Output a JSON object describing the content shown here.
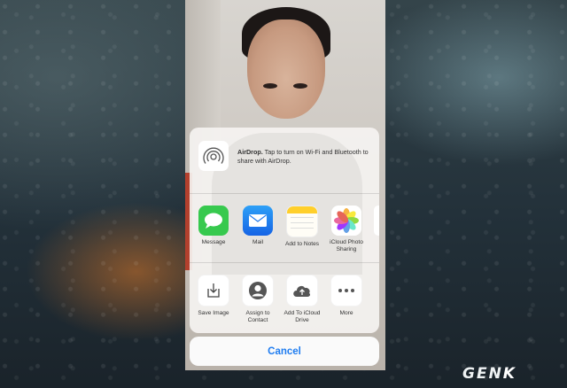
{
  "share_sheet": {
    "airdrop": {
      "title": "AirDrop.",
      "message": "Tap to turn on Wi-Fi and Bluetooth to share with AirDrop."
    },
    "apps": [
      {
        "label": "Message",
        "icon": "messages-icon",
        "color": "#34c759"
      },
      {
        "label": "Mail",
        "icon": "mail-icon",
        "color": "#1e88f0"
      },
      {
        "label": "Add to Notes",
        "icon": "notes-icon",
        "color": "#ffd52b"
      },
      {
        "label": "iCloud Photo Sharing",
        "icon": "photos-icon",
        "color": "#ffffff"
      }
    ],
    "actions": [
      {
        "label": "Save Image",
        "icon": "save-image-icon"
      },
      {
        "label": "Assign to Contact",
        "icon": "contact-icon"
      },
      {
        "label": "Add To iCloud Drive",
        "icon": "icloud-drive-icon"
      },
      {
        "label": "More",
        "icon": "more-icon"
      }
    ],
    "cancel_label": "Cancel",
    "accent_color": "#1e7cf0"
  },
  "watermark": {
    "text_main": "GEN",
    "text_k": "K"
  }
}
